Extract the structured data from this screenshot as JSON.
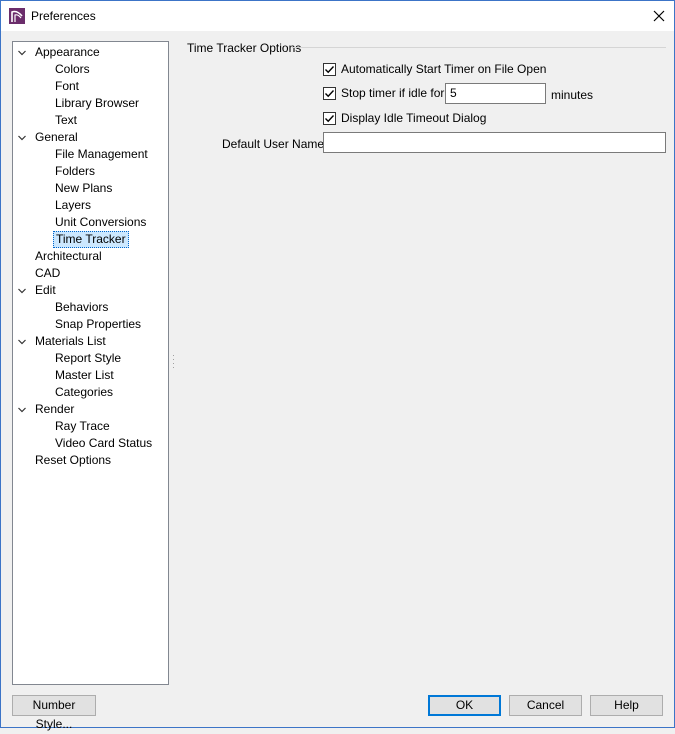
{
  "window": {
    "title": "Preferences"
  },
  "tree": {
    "items": [
      {
        "label": "Appearance",
        "level": 0,
        "expanded": true
      },
      {
        "label": "Colors",
        "level": 1
      },
      {
        "label": "Font",
        "level": 1
      },
      {
        "label": "Library Browser",
        "level": 1
      },
      {
        "label": "Text",
        "level": 1
      },
      {
        "label": "General",
        "level": 0,
        "expanded": true
      },
      {
        "label": "File Management",
        "level": 1
      },
      {
        "label": "Folders",
        "level": 1
      },
      {
        "label": "New Plans",
        "level": 1
      },
      {
        "label": "Layers",
        "level": 1
      },
      {
        "label": "Unit Conversions",
        "level": 1
      },
      {
        "label": "Time Tracker",
        "level": 1,
        "selected": true
      },
      {
        "label": "Architectural",
        "level": 0
      },
      {
        "label": "CAD",
        "level": 0
      },
      {
        "label": "Edit",
        "level": 0,
        "expanded": true
      },
      {
        "label": "Behaviors",
        "level": 1
      },
      {
        "label": "Snap Properties",
        "level": 1
      },
      {
        "label": "Materials List",
        "level": 0,
        "expanded": true
      },
      {
        "label": "Report Style",
        "level": 1
      },
      {
        "label": "Master List",
        "level": 1
      },
      {
        "label": "Categories",
        "level": 1
      },
      {
        "label": "Render",
        "level": 0,
        "expanded": true
      },
      {
        "label": "Ray Trace",
        "level": 1
      },
      {
        "label": "Video Card Status",
        "level": 1
      },
      {
        "label": "Reset Options",
        "level": 0
      }
    ]
  },
  "panel": {
    "group_title": "Time Tracker Options",
    "auto_start": {
      "label": "Automatically Start Timer on File Open",
      "checked": true
    },
    "stop_idle": {
      "label": "Stop timer if idle for",
      "checked": true,
      "value": "5",
      "unit": "minutes"
    },
    "idle_dialog": {
      "label": "Display Idle Timeout Dialog",
      "checked": true
    },
    "default_user": {
      "label": "Default User Name:",
      "value": ""
    }
  },
  "buttons": {
    "number_style": "Number Style...",
    "ok": "OK",
    "cancel": "Cancel",
    "help": "Help"
  },
  "colors": {
    "brand": "#6b2d6b",
    "selection": "#cce8ff",
    "accent": "#0078d7"
  }
}
